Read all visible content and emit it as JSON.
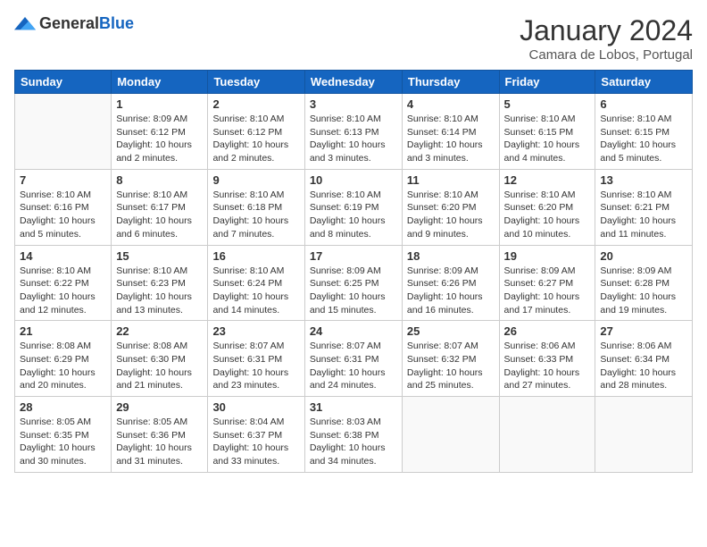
{
  "header": {
    "logo": {
      "general": "General",
      "blue": "Blue"
    },
    "title": "January 2024",
    "location": "Camara de Lobos, Portugal"
  },
  "calendar": {
    "columns": [
      "Sunday",
      "Monday",
      "Tuesday",
      "Wednesday",
      "Thursday",
      "Friday",
      "Saturday"
    ],
    "weeks": [
      [
        {
          "day": "",
          "info": ""
        },
        {
          "day": "1",
          "info": "Sunrise: 8:09 AM\nSunset: 6:12 PM\nDaylight: 10 hours\nand 2 minutes."
        },
        {
          "day": "2",
          "info": "Sunrise: 8:10 AM\nSunset: 6:12 PM\nDaylight: 10 hours\nand 2 minutes."
        },
        {
          "day": "3",
          "info": "Sunrise: 8:10 AM\nSunset: 6:13 PM\nDaylight: 10 hours\nand 3 minutes."
        },
        {
          "day": "4",
          "info": "Sunrise: 8:10 AM\nSunset: 6:14 PM\nDaylight: 10 hours\nand 3 minutes."
        },
        {
          "day": "5",
          "info": "Sunrise: 8:10 AM\nSunset: 6:15 PM\nDaylight: 10 hours\nand 4 minutes."
        },
        {
          "day": "6",
          "info": "Sunrise: 8:10 AM\nSunset: 6:15 PM\nDaylight: 10 hours\nand 5 minutes."
        }
      ],
      [
        {
          "day": "7",
          "info": "Sunrise: 8:10 AM\nSunset: 6:16 PM\nDaylight: 10 hours\nand 5 minutes."
        },
        {
          "day": "8",
          "info": "Sunrise: 8:10 AM\nSunset: 6:17 PM\nDaylight: 10 hours\nand 6 minutes."
        },
        {
          "day": "9",
          "info": "Sunrise: 8:10 AM\nSunset: 6:18 PM\nDaylight: 10 hours\nand 7 minutes."
        },
        {
          "day": "10",
          "info": "Sunrise: 8:10 AM\nSunset: 6:19 PM\nDaylight: 10 hours\nand 8 minutes."
        },
        {
          "day": "11",
          "info": "Sunrise: 8:10 AM\nSunset: 6:20 PM\nDaylight: 10 hours\nand 9 minutes."
        },
        {
          "day": "12",
          "info": "Sunrise: 8:10 AM\nSunset: 6:20 PM\nDaylight: 10 hours\nand 10 minutes."
        },
        {
          "day": "13",
          "info": "Sunrise: 8:10 AM\nSunset: 6:21 PM\nDaylight: 10 hours\nand 11 minutes."
        }
      ],
      [
        {
          "day": "14",
          "info": "Sunrise: 8:10 AM\nSunset: 6:22 PM\nDaylight: 10 hours\nand 12 minutes."
        },
        {
          "day": "15",
          "info": "Sunrise: 8:10 AM\nSunset: 6:23 PM\nDaylight: 10 hours\nand 13 minutes."
        },
        {
          "day": "16",
          "info": "Sunrise: 8:10 AM\nSunset: 6:24 PM\nDaylight: 10 hours\nand 14 minutes."
        },
        {
          "day": "17",
          "info": "Sunrise: 8:09 AM\nSunset: 6:25 PM\nDaylight: 10 hours\nand 15 minutes."
        },
        {
          "day": "18",
          "info": "Sunrise: 8:09 AM\nSunset: 6:26 PM\nDaylight: 10 hours\nand 16 minutes."
        },
        {
          "day": "19",
          "info": "Sunrise: 8:09 AM\nSunset: 6:27 PM\nDaylight: 10 hours\nand 17 minutes."
        },
        {
          "day": "20",
          "info": "Sunrise: 8:09 AM\nSunset: 6:28 PM\nDaylight: 10 hours\nand 19 minutes."
        }
      ],
      [
        {
          "day": "21",
          "info": "Sunrise: 8:08 AM\nSunset: 6:29 PM\nDaylight: 10 hours\nand 20 minutes."
        },
        {
          "day": "22",
          "info": "Sunrise: 8:08 AM\nSunset: 6:30 PM\nDaylight: 10 hours\nand 21 minutes."
        },
        {
          "day": "23",
          "info": "Sunrise: 8:07 AM\nSunset: 6:31 PM\nDaylight: 10 hours\nand 23 minutes."
        },
        {
          "day": "24",
          "info": "Sunrise: 8:07 AM\nSunset: 6:31 PM\nDaylight: 10 hours\nand 24 minutes."
        },
        {
          "day": "25",
          "info": "Sunrise: 8:07 AM\nSunset: 6:32 PM\nDaylight: 10 hours\nand 25 minutes."
        },
        {
          "day": "26",
          "info": "Sunrise: 8:06 AM\nSunset: 6:33 PM\nDaylight: 10 hours\nand 27 minutes."
        },
        {
          "day": "27",
          "info": "Sunrise: 8:06 AM\nSunset: 6:34 PM\nDaylight: 10 hours\nand 28 minutes."
        }
      ],
      [
        {
          "day": "28",
          "info": "Sunrise: 8:05 AM\nSunset: 6:35 PM\nDaylight: 10 hours\nand 30 minutes."
        },
        {
          "day": "29",
          "info": "Sunrise: 8:05 AM\nSunset: 6:36 PM\nDaylight: 10 hours\nand 31 minutes."
        },
        {
          "day": "30",
          "info": "Sunrise: 8:04 AM\nSunset: 6:37 PM\nDaylight: 10 hours\nand 33 minutes."
        },
        {
          "day": "31",
          "info": "Sunrise: 8:03 AM\nSunset: 6:38 PM\nDaylight: 10 hours\nand 34 minutes."
        },
        {
          "day": "",
          "info": ""
        },
        {
          "day": "",
          "info": ""
        },
        {
          "day": "",
          "info": ""
        }
      ]
    ]
  }
}
